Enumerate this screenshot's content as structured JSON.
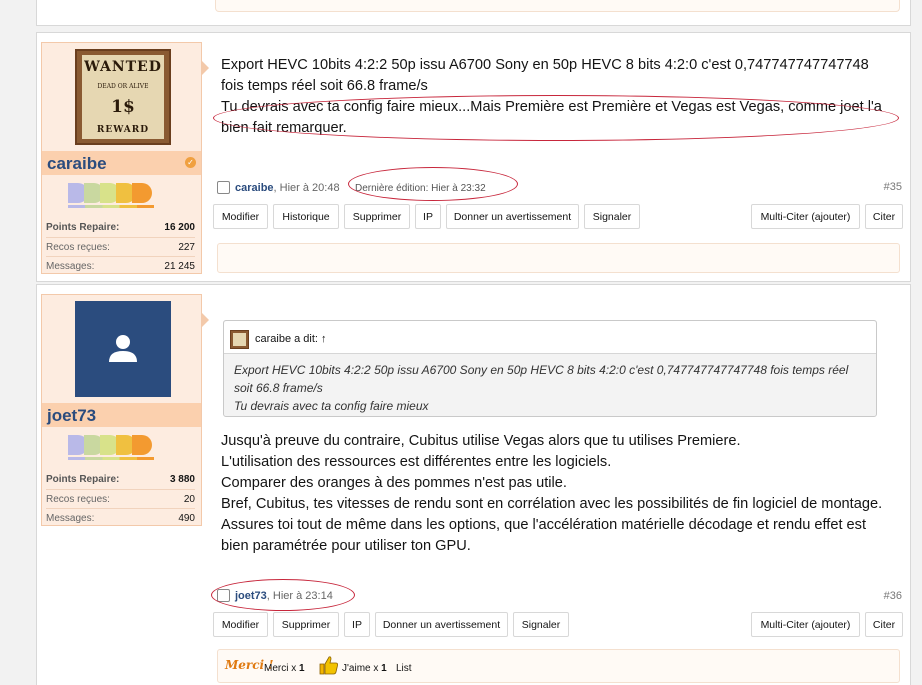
{
  "posts": [
    {
      "username": "caraibe",
      "avatar": {
        "type": "wanted-poster",
        "wanted": "WANTED",
        "dead_or_alive": "DEAD OR ALIVE",
        "amount": "1$",
        "reward": "REWARD"
      },
      "stats": [
        {
          "label": "Points Repaire:",
          "value": "16 200",
          "bold": true
        },
        {
          "label": "Recos reçues:",
          "value": "227",
          "bold": false
        },
        {
          "label": "Messages:",
          "value": "21 245",
          "bold": false
        }
      ],
      "body": [
        "Export HEVC 10bits 4:2:2 50p issu A6700 Sony en 50p HEVC 8 bits 4:2:0 c'est 0,747747747747748 fois temps réel soit 66.8 frame/s",
        "Tu devrais avec ta config faire mieux...Mais Première est Première et Vegas est Vegas, comme joet l'a bien fait remarquer."
      ],
      "author": "caraibe",
      "time": ", Hier à 20:48",
      "edited": "Dernière édition: Hier à 23:32",
      "number": "#35",
      "actions": [
        "Modifier",
        "Historique",
        "Supprimer",
        "IP",
        "Donner un avertissement",
        "Signaler"
      ],
      "actions_right": [
        "Multi-Citer (ajouter)",
        "Citer"
      ]
    },
    {
      "username": "joet73",
      "avatar": {
        "type": "default-silhouette"
      },
      "stats": [
        {
          "label": "Points Repaire:",
          "value": "3 880",
          "bold": true
        },
        {
          "label": "Recos reçues:",
          "value": "20",
          "bold": false
        },
        {
          "label": "Messages:",
          "value": "490",
          "bold": false
        }
      ],
      "quote": {
        "who": "caraibe a dit: ↑",
        "lines": [
          "Export HEVC 10bits 4:2:2 50p issu A6700 Sony en 50p HEVC 8 bits 4:2:0 c'est 0,747747747747748 fois temps réel soit 66.8 frame/s",
          "Tu devrais avec ta config faire mieux"
        ]
      },
      "body": [
        "Jusqu'à preuve du contraire, Cubitus utilise Vegas alors que tu utilises Premiere.",
        "L'utilisation des ressources est différentes entre les logiciels.",
        "Comparer des oranges à des pommes n'est pas utile.",
        "Bref, Cubitus, tes vitesses de rendu sont en corrélation avec les possibilités de fin logiciel de montage.",
        "Assures toi tout de même dans les options, que l'accélération matérielle décodage et rendu effet est bien paramétrée pour utiliser ton GPU."
      ],
      "author": "joet73",
      "time": ", Hier à 23:14",
      "number": "#36",
      "actions": [
        "Modifier",
        "Supprimer",
        "IP",
        "Donner un avertissement",
        "Signaler"
      ],
      "actions_right": [
        "Multi-Citer (ajouter)",
        "Citer"
      ],
      "reactions": {
        "merci_logo": "Merci !",
        "merci": "Merci x ",
        "merci_count": "1",
        "jaime": "J'aime x ",
        "jaime_count": "1",
        "list": "List"
      }
    }
  ],
  "colors": {
    "accent": "#2b4c7e",
    "card_bg": "#fdece0",
    "highlight": "#c7263b"
  },
  "rank_colors": [
    "#b9b9e8",
    "#c9d8a0",
    "#d8e28a",
    "#f0c040",
    "#f39a30"
  ]
}
